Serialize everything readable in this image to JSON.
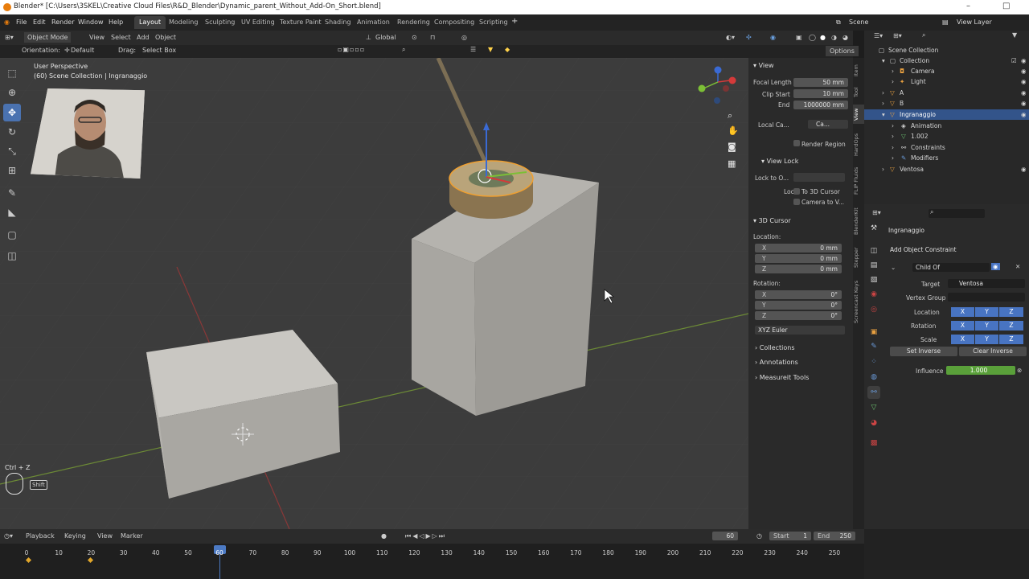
{
  "title": "Blender* [C:\\Users\\3SKEL\\Creative Cloud Files\\R&D_Blender\\Dynamic_parent_Without_Add-On_Short.blend]",
  "menu": [
    "File",
    "Edit",
    "Render",
    "Window",
    "Help"
  ],
  "workspaces": [
    "Layout",
    "Modeling",
    "Sculpting",
    "UV Editing",
    "Texture Paint",
    "Shading",
    "Animation",
    "Rendering",
    "Compositing",
    "Scripting"
  ],
  "scene": {
    "scene_label": "Scene",
    "view_layer": "View Layer"
  },
  "viewport_header": {
    "mode": "Object Mode",
    "view": "View",
    "select": "Select",
    "add": "Add",
    "object": "Object",
    "transform": "Global",
    "orientation_label": "Orientation:",
    "orientation": "Default",
    "drag_label": "Drag:",
    "drag": "Select Box",
    "options": "Options"
  },
  "overlay": {
    "perspective": "User Perspective",
    "collection": "(60) Scene Collection | Ingranaggio",
    "shortcut": "Ctrl + Z",
    "shift": "Shift"
  },
  "npanel": {
    "view_header": "View",
    "focal_label": "Focal Length",
    "focal_value": "50 mm",
    "clip_start_label": "Clip Start",
    "clip_start_value": "10 mm",
    "clip_end_label": "End",
    "clip_end_value": "1000000 mm",
    "local_camera_label": "Local Ca...",
    "local_camera_value": "Ca...",
    "render_region": "Render Region",
    "view_lock_header": "View Lock",
    "lock_to_object_label": "Lock to O...",
    "lock_label": "Lock",
    "lock_3d_cursor": "To 3D Cursor",
    "camera_to_view": "Camera to V...",
    "cursor_header": "3D Cursor",
    "location_label": "Location:",
    "loc_x": "0 mm",
    "loc_y": "0 mm",
    "loc_z": "0 mm",
    "rotation_label": "Rotation:",
    "rot_x": "0°",
    "rot_y": "0°",
    "rot_z": "0°",
    "x": "X",
    "y": "Y",
    "z": "Z",
    "rotation_mode": "XYZ Euler",
    "collections": "Collections",
    "annotations": "Annotations",
    "measureit": "Measureit Tools",
    "tabs": [
      "Item",
      "Tool",
      "View",
      "HardOps",
      "FLIP Fluids",
      "BlenderKit",
      "Stepper",
      "Screencast Keys"
    ]
  },
  "outliner": {
    "rows": [
      {
        "label": "Scene Collection",
        "indent": 0
      },
      {
        "label": "Collection",
        "indent": 1
      },
      {
        "label": "Camera",
        "indent": 2
      },
      {
        "label": "Light",
        "indent": 2
      },
      {
        "label": "A",
        "indent": 1
      },
      {
        "label": "B",
        "indent": 1
      },
      {
        "label": "Ingranaggio",
        "indent": 1,
        "selected": true
      },
      {
        "label": "Animation",
        "indent": 2
      },
      {
        "label": "1.002",
        "indent": 2
      },
      {
        "label": "Constraints",
        "indent": 2
      },
      {
        "label": "Modifiers",
        "indent": 2
      },
      {
        "label": "Ventosa",
        "indent": 1
      }
    ]
  },
  "properties": {
    "object_name": "Ingranaggio",
    "add_constraint": "Add Object Constraint",
    "constraint_name": "Child Of",
    "target_label": "Target",
    "target_value": "Ventosa",
    "vertex_group_label": "Vertex Group",
    "location_label": "Location",
    "rotation_label": "Rotation",
    "scale_label": "Scale",
    "x": "X",
    "y": "Y",
    "z": "Z",
    "set_inverse": "Set Inverse",
    "clear_inverse": "Clear Inverse",
    "influence_label": "Influence",
    "influence_value": "1.000"
  },
  "timeline": {
    "playback": "Playback",
    "keying": "Keying",
    "view": "View",
    "marker": "Marker",
    "current_frame": "60",
    "start_label": "Start",
    "start": "1",
    "end_label": "End",
    "end": "250",
    "ticks": [
      "0",
      "10",
      "20",
      "30",
      "40",
      "50",
      "60",
      "70",
      "80",
      "90",
      "100",
      "110",
      "120",
      "130",
      "140",
      "150",
      "160",
      "170",
      "180",
      "190",
      "200",
      "210",
      "220",
      "230",
      "240",
      "250"
    ]
  },
  "colors": {
    "accent": "#4772b3",
    "selection": "#e58a18",
    "keyframe": "#e2a72a",
    "influence": "#5aa03a"
  }
}
